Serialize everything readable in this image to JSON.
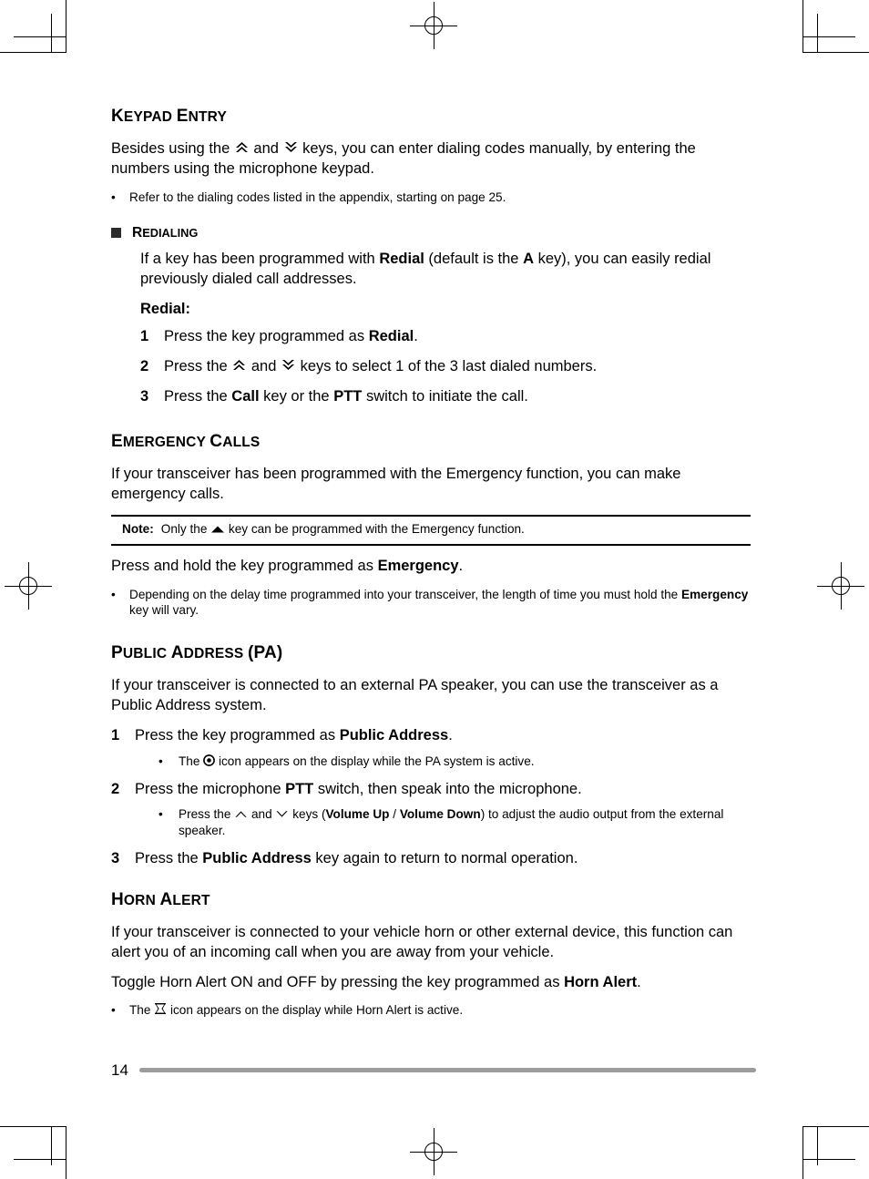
{
  "page": {
    "number": "14"
  },
  "sections": {
    "keypad_entry": {
      "heading_first": "K",
      "heading_rest_1": "EYPAD ",
      "heading_first_2": "E",
      "heading_rest_2": "NTRY",
      "heading_plain": "Keypad Entry",
      "para_a": "Besides using the ",
      "para_b": " and ",
      "para_c": " keys, you can enter dialing codes manually, by entering the numbers using the microphone keypad.",
      "bullet_1": "Refer to the dialing codes listed in the appendix, starting on page 25.",
      "bullet_char": "•"
    },
    "redialing": {
      "heading_first": "R",
      "heading_rest": "EDIALING",
      "heading_plain": "Redialing",
      "para_a": "If a key has been programmed with ",
      "para_redial_bold": "Redial",
      "para_b": " (default is the ",
      "para_a_bold": "A",
      "para_c": " key), you can easily redial previously dialed call addresses.",
      "redial_label": "Redial:",
      "steps": [
        {
          "num": "1",
          "a": "Press the key programmed as ",
          "bold": "Redial",
          "b": "."
        },
        {
          "num": "2",
          "a": "Press the ",
          "mid": " and ",
          "b": " keys to select 1 of the 3 last dialed numbers."
        },
        {
          "num": "3",
          "a": "Press the ",
          "bold": "Call",
          "b": " key or the ",
          "bold2": "PTT",
          "c": " switch to initiate the call."
        }
      ]
    },
    "emergency_calls": {
      "heading_first": "E",
      "heading_rest_1": "MERGENCY ",
      "heading_first_2": "C",
      "heading_rest_2": "ALLS",
      "heading_plain": "Emergency Calls",
      "para_1": "If your transceiver has been programmed with the Emergency function, you can make emergency calls.",
      "note_label": "Note:",
      "note_a": "Only the ",
      "note_b": " key can be programmed with the Emergency function.",
      "para_2_a": "Press and hold the key programmed as ",
      "para_2_bold": "Emergency",
      "para_2_b": ".",
      "bullet_a": "Depending on the delay time programmed into your transceiver, the length of time you must hold the ",
      "bullet_bold": "Emergency",
      "bullet_b": " key will vary.",
      "bullet_char": "•"
    },
    "public_address": {
      "heading_first": "P",
      "heading_rest_1": "UBLIC ",
      "heading_first_2": "A",
      "heading_rest_2": "DDRESS ",
      "heading_tail": "(PA)",
      "heading_plain": "Public Address (PA)",
      "para_1": "If your transceiver is connected to an external PA speaker, you can use the transceiver as a Public Address system.",
      "steps": [
        {
          "num": "1",
          "a": "Press the key programmed as ",
          "bold": "Public Address",
          "b": ".",
          "sub_a": "The ",
          "sub_b": " icon appears on the display while the PA system is active."
        },
        {
          "num": "2",
          "a": "Press the microphone ",
          "bold": "PTT",
          "b": " switch, then speak into the microphone.",
          "sub_a": "Press the ",
          "sub_mid": " and ",
          "sub_b": " keys (",
          "sub_bold1": "Volume Up",
          "sub_sep": " / ",
          "sub_bold2": "Volume Down",
          "sub_c": ") to adjust the audio output from the external speaker."
        },
        {
          "num": "3",
          "a": "Press the ",
          "bold": "Public Address",
          "b": " key again to return to normal operation."
        }
      ],
      "bullet_char": "•"
    },
    "horn_alert": {
      "heading_first": "H",
      "heading_rest_1": "ORN ",
      "heading_first_2": "A",
      "heading_rest_2": "LERT",
      "heading_plain": "Horn Alert",
      "para_1": "If your transceiver is connected to your vehicle horn or other external device, this function can alert you of an incoming call when you are away from your vehicle.",
      "para_2_a": "Toggle Horn Alert ON and OFF by pressing the key programmed as ",
      "para_2_bold": "Horn Alert",
      "para_2_b": ".",
      "bullet_a": "The ",
      "bullet_b": " icon appears on the display while Horn Alert is active.",
      "bullet_char": "•"
    }
  },
  "icons": {
    "double_chevron_up": "double-chevron-up-key-icon",
    "double_chevron_down": "double-chevron-down-key-icon",
    "chevron_up": "chevron-up-key-icon",
    "chevron_down": "chevron-down-key-icon",
    "triangle": "triangle-key-icon",
    "pa_bullseye": "pa-bullseye-icon",
    "horn": "horn-alert-icon"
  },
  "colors": {
    "text": "#000000",
    "footer_rule": "#9c9c9c",
    "bullet_square": "#2b2b2b"
  }
}
